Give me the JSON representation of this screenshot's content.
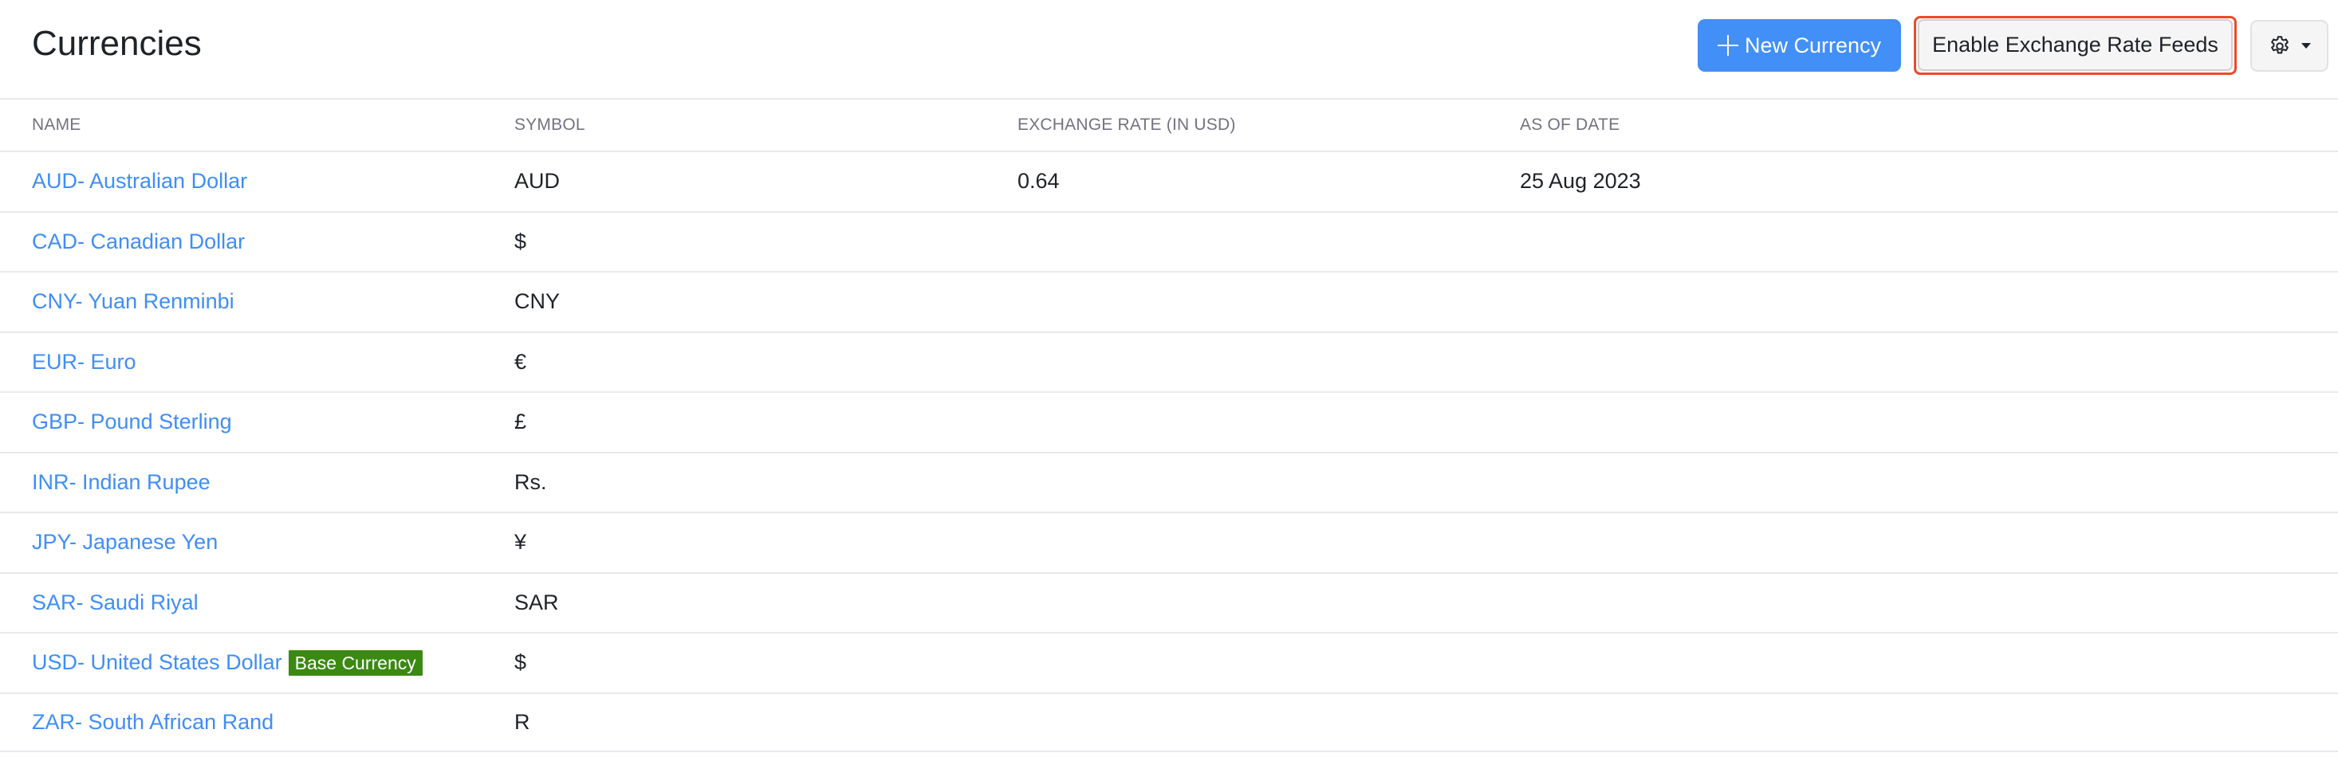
{
  "header": {
    "title": "Currencies",
    "new_button_label": "New Currency",
    "new_button_icon": "plus-icon",
    "feeds_button_label": "Enable Exchange Rate Feeds",
    "settings_button_icon": "gear-icon",
    "settings_caret_icon": "caret-down-icon"
  },
  "table": {
    "columns": [
      "NAME",
      "SYMBOL",
      "EXCHANGE RATE (IN USD)",
      "AS OF DATE"
    ],
    "rows": [
      {
        "name": "AUD- Australian Dollar",
        "symbol": "AUD",
        "rate": "0.64",
        "date": "25 Aug 2023",
        "badge": ""
      },
      {
        "name": "CAD- Canadian Dollar",
        "symbol": "$",
        "rate": "",
        "date": "",
        "badge": ""
      },
      {
        "name": "CNY- Yuan Renminbi",
        "symbol": "CNY",
        "rate": "",
        "date": "",
        "badge": ""
      },
      {
        "name": "EUR- Euro",
        "symbol": "€",
        "rate": "",
        "date": "",
        "badge": ""
      },
      {
        "name": "GBP- Pound Sterling",
        "symbol": "£",
        "rate": "",
        "date": "",
        "badge": ""
      },
      {
        "name": "INR- Indian Rupee",
        "symbol": "Rs.",
        "rate": "",
        "date": "",
        "badge": ""
      },
      {
        "name": "JPY- Japanese Yen",
        "symbol": "¥",
        "rate": "",
        "date": "",
        "badge": ""
      },
      {
        "name": "SAR- Saudi Riyal",
        "symbol": "SAR",
        "rate": "",
        "date": "",
        "badge": ""
      },
      {
        "name": "USD- United States Dollar",
        "symbol": "$",
        "rate": "",
        "date": "",
        "badge": "Base Currency"
      },
      {
        "name": "ZAR- South African Rand",
        "symbol": "R",
        "rate": "",
        "date": "",
        "badge": ""
      }
    ]
  },
  "colors": {
    "primary": "#428ff7",
    "link": "#3f8ef5",
    "badge": "#3a8a12",
    "highlight": "#ec4a2a"
  }
}
